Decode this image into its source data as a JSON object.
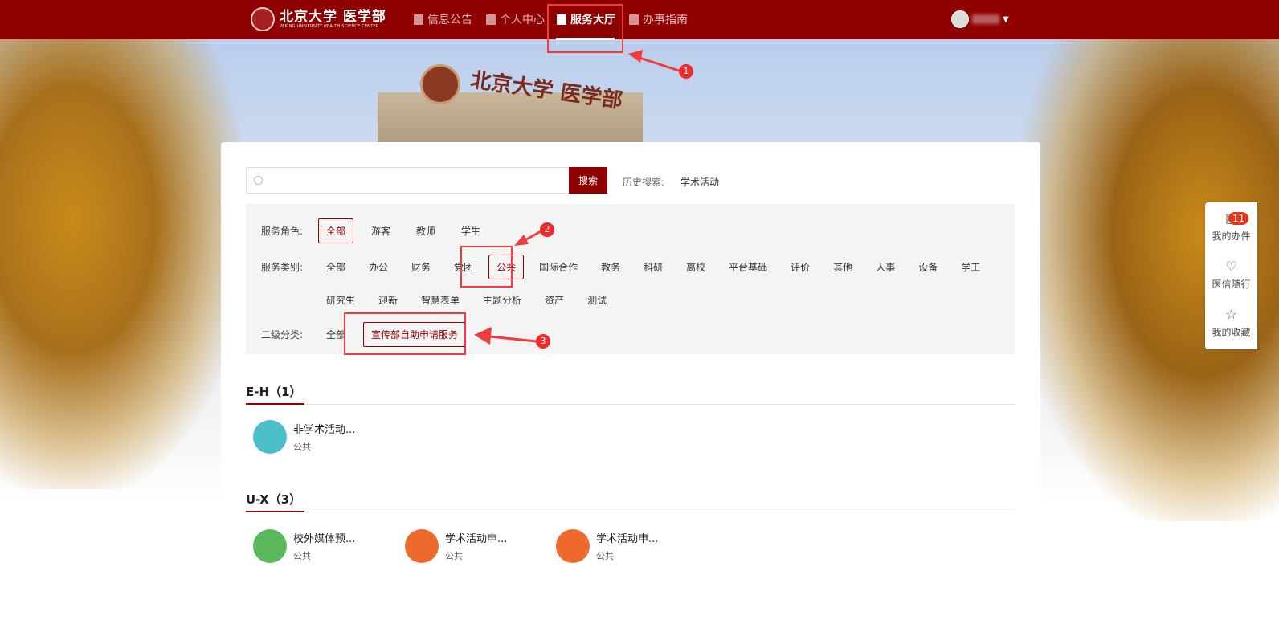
{
  "nav": {
    "logo_text": "北京大学 医学部",
    "logo_sub": "PEKING UNIVERSITY HEALTH SCIENCE CENTER",
    "items": [
      {
        "label": "信息公告",
        "icon": "bank-icon"
      },
      {
        "label": "个人中心",
        "icon": "user-doc-icon"
      },
      {
        "label": "服务大厅",
        "icon": "service-doc-icon",
        "active": true
      },
      {
        "label": "办事指南",
        "icon": "guide-icon"
      }
    ]
  },
  "search": {
    "placeholder": "",
    "button": "搜索",
    "history_label": "历史搜索:",
    "history_items": [
      "学术活动"
    ]
  },
  "filters": {
    "role": {
      "label": "服务角色:",
      "options": [
        "全部",
        "游客",
        "教师",
        "学生"
      ],
      "selected": "全部"
    },
    "category": {
      "label": "服务类别:",
      "options": [
        "全部",
        "办公",
        "财务",
        "党团",
        "公共",
        "国际合作",
        "教务",
        "科研",
        "离校",
        "平台基础",
        "评价",
        "其他",
        "人事",
        "设备",
        "学工",
        "研究生",
        "迎新",
        "智慧表单",
        "主题分析",
        "资产",
        "测试"
      ],
      "selected": "公共"
    },
    "sub": {
      "label": "二级分类:",
      "options": [
        "全部",
        "宣传部自助申请服务"
      ],
      "selected": "宣传部自助申请服务"
    }
  },
  "sections": [
    {
      "title": "E-H（1）",
      "items": [
        {
          "name": "非学术活动...",
          "category": "公共",
          "icon_color": "#4bbfc8"
        }
      ]
    },
    {
      "title": "U-X（3）",
      "items": [
        {
          "name": "校外媒体预...",
          "category": "公共",
          "icon_color": "#5cb85c"
        },
        {
          "name": "学术活动申...",
          "category": "公共",
          "icon_color": "#ee6a2c"
        },
        {
          "name": "学术活动申...",
          "category": "公共",
          "icon_color": "#ee6a2c"
        }
      ]
    }
  ],
  "side": {
    "items": [
      {
        "label": "我的办件",
        "badge": "11",
        "icon": "document-icon"
      },
      {
        "label": "医信随行",
        "icon": "heart-icon"
      },
      {
        "label": "我的收藏",
        "icon": "star-icon"
      }
    ]
  },
  "annotations": [
    "1",
    "2",
    "3"
  ],
  "colors": {
    "brand": "#8f0000",
    "annotation": "#f03c3c"
  }
}
